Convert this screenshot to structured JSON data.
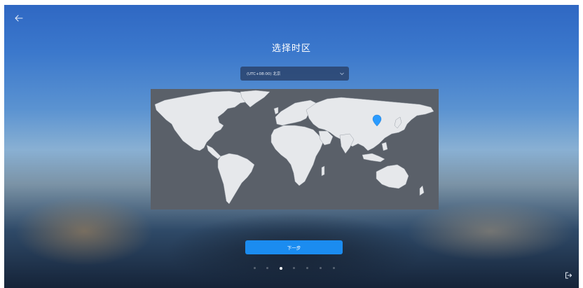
{
  "page": {
    "title": "选择时区"
  },
  "timezone": {
    "selected": "(UTC+08:00) 北京",
    "marker_city": "北京"
  },
  "actions": {
    "next_label": "下一步"
  },
  "pager": {
    "total": 7,
    "current": 3
  },
  "icons": {
    "back": "back-arrow-icon",
    "dropdown": "chevron-down-icon",
    "marker": "location-pin-icon",
    "exit": "exit-icon"
  },
  "colors": {
    "accent": "#1b8cf0",
    "marker": "#2a9bff",
    "land": "#e6e8eb",
    "ocean": "#5a6069"
  }
}
